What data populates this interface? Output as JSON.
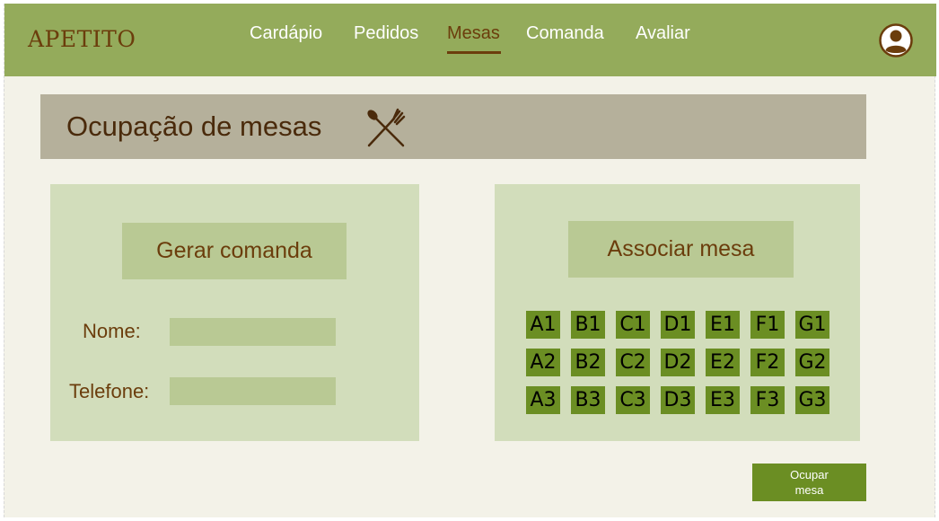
{
  "header": {
    "logo": "APETITO",
    "nav": [
      {
        "label": "Cardápio",
        "active": false
      },
      {
        "label": "Pedidos",
        "active": false
      },
      {
        "label": "Mesas",
        "active": true
      },
      {
        "label": "Comanda",
        "active": false
      },
      {
        "label": "Avaliar",
        "active": false
      }
    ],
    "avatar_icon": "user-circle-icon"
  },
  "page": {
    "title": "Ocupação de mesas",
    "title_icon": "fork-spoon-icon"
  },
  "left_panel": {
    "button_label": "Gerar comanda",
    "fields": [
      {
        "label": "Nome:",
        "value": "",
        "placeholder": ""
      },
      {
        "label": "Telefone:",
        "value": "",
        "placeholder": ""
      }
    ]
  },
  "right_panel": {
    "button_label": "Associar mesa",
    "tables": [
      [
        "A1",
        "B1",
        "C1",
        "D1",
        "E1",
        "F1",
        "G1"
      ],
      [
        "A2",
        "B2",
        "C2",
        "D2",
        "E2",
        "F2",
        "G2"
      ],
      [
        "A3",
        "B3",
        "C3",
        "D3",
        "E3",
        "F3",
        "G3"
      ]
    ]
  },
  "actions": {
    "occupy_label": "Ocupar mesa"
  },
  "colors": {
    "navbar": "#94ab5b",
    "brand_brown": "#6b3d0c",
    "title_bar": "#b5b09b",
    "panel": "#d2ddbb",
    "panel_button": "#b9c994",
    "table_cell": "#6b8e23",
    "background": "#f3f2e8"
  }
}
